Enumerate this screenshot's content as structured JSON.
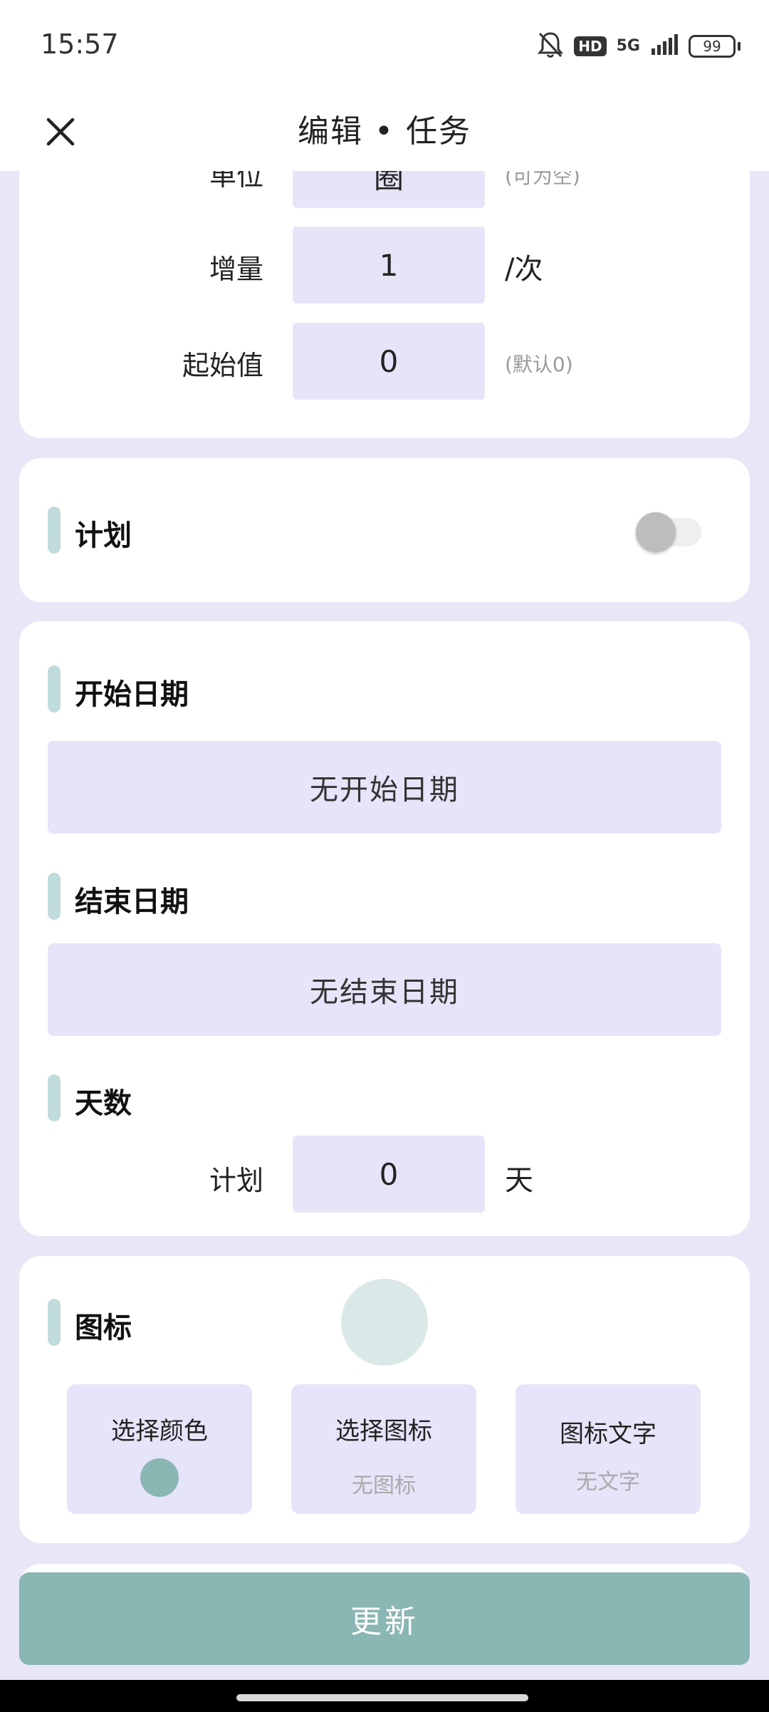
{
  "status_bar": {
    "time": "15:57",
    "hd_badge": "HD",
    "network": "5G",
    "battery": "99"
  },
  "header": {
    "title": "编辑 • 任务",
    "close_icon": "close-icon"
  },
  "counter_card": {
    "unit_row": {
      "label": "单位",
      "value": "圈",
      "hint": "(可为空)"
    },
    "increment_row": {
      "label": "增量",
      "value": "1",
      "suffix": "/次"
    },
    "start_row": {
      "label": "起始值",
      "value": "0",
      "hint": "(默认0)"
    }
  },
  "plan_card": {
    "title": "计划",
    "toggle_on": false
  },
  "date_card": {
    "start_date_title": "开始日期",
    "start_date_value": "无开始日期",
    "end_date_title": "结束日期",
    "end_date_value": "无结束日期",
    "days_title": "天数",
    "days_label": "计划",
    "days_value": "0",
    "days_unit": "天"
  },
  "icon_card": {
    "title": "图标",
    "preview_color": "#DAE9E8",
    "buttons": {
      "color": {
        "label": "选择颜色",
        "swatch": "#8AB6B3"
      },
      "icon": {
        "label": "选择图标",
        "sub": "无图标"
      },
      "text": {
        "label": "图标文字",
        "sub": "无文字"
      }
    }
  },
  "footer": {
    "update_label": "更新"
  }
}
